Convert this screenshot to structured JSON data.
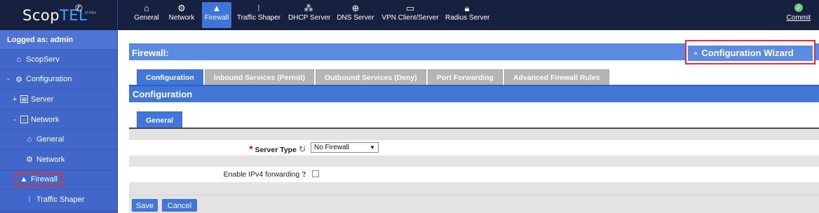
{
  "brand": {
    "logo_main": "Scop",
    "logo_accent": "TEL",
    "logo_sub": "IP PBX",
    "phone_icon": "phone-icon"
  },
  "colors": {
    "sidebar": "#4067c9",
    "topbar": "#16213f",
    "accent": "#4077d8",
    "highlight_border": "#e0303a"
  },
  "sidebar": {
    "user": "Logged as: admin",
    "items": [
      {
        "label": "ScopServ",
        "icon": "home-icon",
        "toggle": ""
      },
      {
        "label": "Configuration",
        "icon": "gear-icon",
        "toggle": "-"
      },
      {
        "label": "Server",
        "icon": "server-icon",
        "toggle": "+"
      },
      {
        "label": "Network",
        "icon": "network-icon",
        "toggle": "-"
      },
      {
        "label": "General",
        "icon": "home-icon",
        "toggle": ""
      },
      {
        "label": "Network",
        "icon": "gear-icon",
        "toggle": ""
      },
      {
        "label": "Firewall",
        "icon": "firewall-icon",
        "toggle": ""
      },
      {
        "label": "Traffic Shaper",
        "icon": "traffic-light-icon",
        "toggle": ""
      }
    ]
  },
  "topnav": {
    "items": [
      {
        "label": "General",
        "icon": "home-icon"
      },
      {
        "label": "Network",
        "icon": "gear-icon"
      },
      {
        "label": "Firewall",
        "icon": "firewall-icon"
      },
      {
        "label": "Traffic Shaper",
        "icon": "traffic-light-icon"
      },
      {
        "label": "DHCP Server",
        "icon": "sitemap-icon"
      },
      {
        "label": "DNS Server",
        "icon": "globe-icon"
      },
      {
        "label": "VPN Client/Server",
        "icon": "monitor-icon"
      },
      {
        "label": "Radius Server",
        "icon": "lock-icon"
      }
    ],
    "commit": "Commit"
  },
  "page": {
    "title": "Firewall:",
    "wizard": "Configuration Wizard",
    "tabs": [
      "Configuration",
      "Inbound Services (Permit)",
      "Outbound Services (Deny)",
      "Port Forwarding",
      "Advanced Firewall Rules"
    ],
    "section_title": "Configuration",
    "subtab": "General"
  },
  "form": {
    "server_type_label": "Server Type",
    "server_type_value": "No Firewall",
    "ipv4_label": "Enable IPv4 forwarding ?",
    "ipv4_checked": false,
    "colon": ":"
  },
  "buttons": {
    "save": "Save",
    "cancel": "Cancel"
  }
}
